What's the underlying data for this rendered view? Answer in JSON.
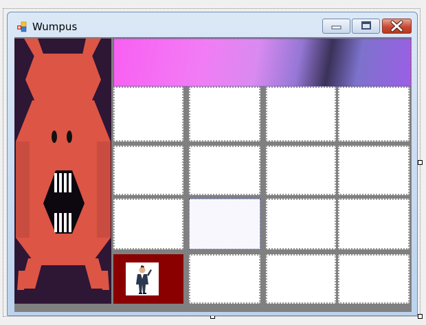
{
  "window": {
    "title": "Wumpus"
  },
  "controls": {
    "minimize": "minimize-icon",
    "maximize": "maximize-icon",
    "close": "close-icon"
  },
  "colors": {
    "wumpus_bg": "#2e1635",
    "wumpus_body": "#dd5545",
    "player_cell": "#8a0000",
    "banner_pink": "#f85ff2",
    "banner_purple": "#9b5fe6"
  },
  "board": {
    "rows": 4,
    "cols": 4,
    "active_cell": [
      2,
      1
    ],
    "player_cell": [
      3,
      0
    ]
  }
}
